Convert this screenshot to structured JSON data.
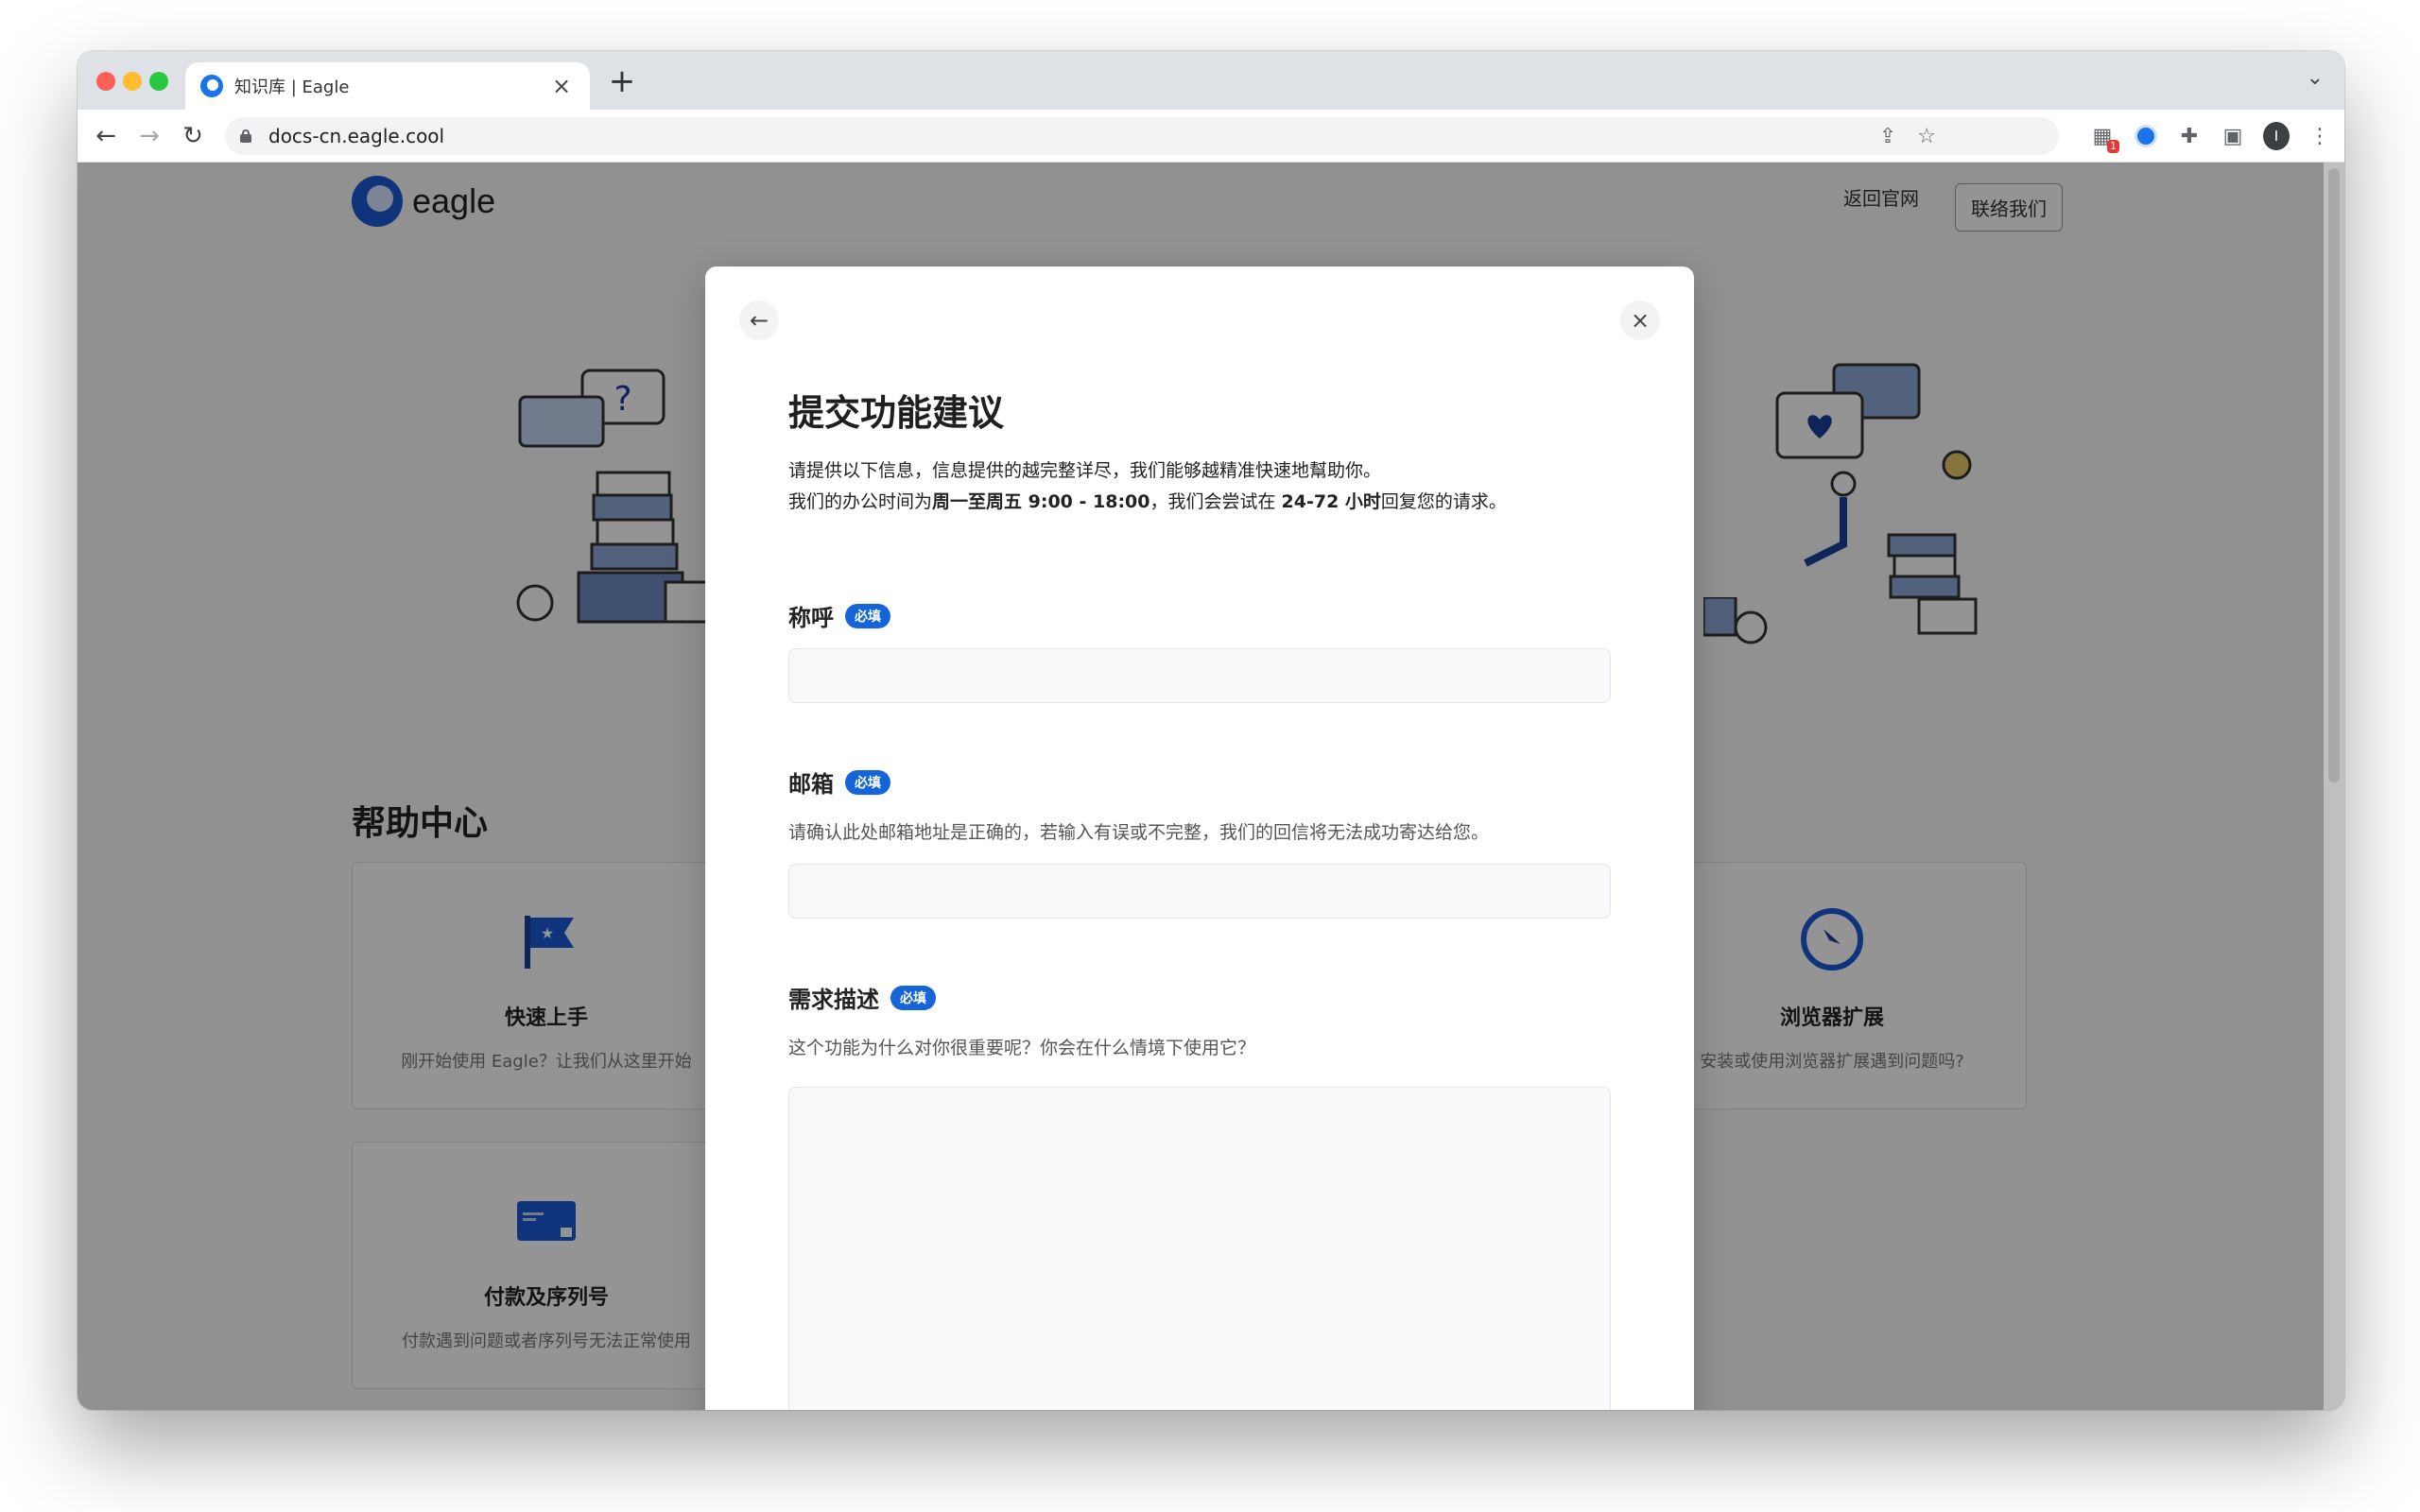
{
  "browser": {
    "tab_title": "知识库 | Eagle",
    "tab_close": "×",
    "new_tab": "+",
    "tab_menu": "⌄",
    "back": "←",
    "forward": "→",
    "reload": "↻",
    "url": "docs-cn.eagle.cool",
    "share": "⇪",
    "bookmark": "☆",
    "ext_badge": "1",
    "puzzle": "✚",
    "sidepanel": "▣",
    "profile_initial": "I",
    "more": "⋮"
  },
  "site": {
    "logo_text": "eagle",
    "nav_home": "返回官网",
    "nav_contact": "联络我们",
    "help_title": "帮助中心",
    "cards": [
      {
        "title": "快速上手",
        "desc": "刚开始使用 Eagle？让我们从这里开始"
      },
      {
        "title": "浏览器扩展",
        "desc": "安装或使用浏览器扩展遇到问题吗?"
      },
      {
        "title": "付款及序列号",
        "desc": "付款遇到问题或者序列号无法正常使用"
      }
    ]
  },
  "modal": {
    "back": "←",
    "close": "×",
    "title": "提交功能建议",
    "intro_line1": "请提供以下信息，信息提供的越完整详尽，我们能够越精准快速地幫助你。",
    "intro_line2_a": "我们的办公时间为",
    "intro_line2_b": "周一至周五 9:00 - 18:00",
    "intro_line2_c": "，我们会尝试在 ",
    "intro_line2_d": "24-72 小时",
    "intro_line2_e": "回复您的请求。",
    "required": "必填",
    "name_label": "称呼",
    "name_value": "",
    "email_label": "邮箱",
    "email_help": "请确认此处邮箱地址是正确的，若输入有误或不完整，我们的回信将无法成功寄达给您。",
    "email_value": "",
    "desc_label": "需求描述",
    "desc_help": "这个功能为什么对你很重要呢？你会在什么情境下使用它？",
    "desc_value": ""
  },
  "colors": {
    "accent": "#1565d8",
    "overlay": "#000000"
  }
}
